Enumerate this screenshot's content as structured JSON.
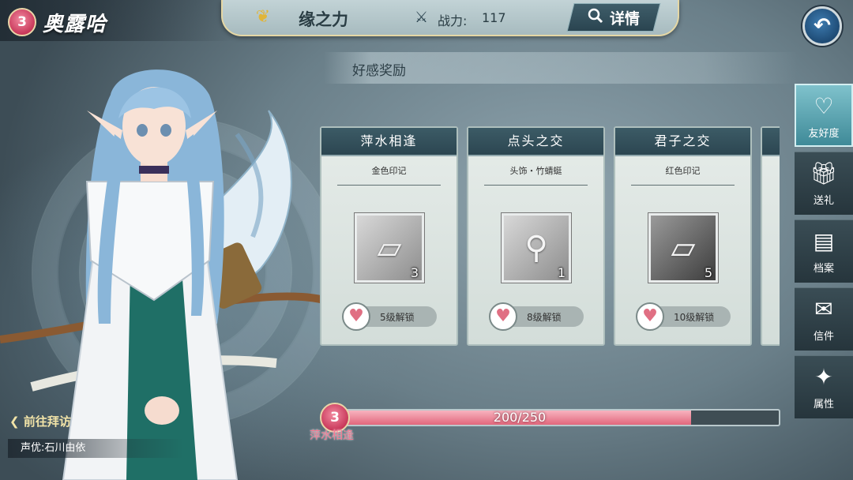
{
  "header": {
    "level": "3",
    "name": "奥露哈",
    "title": "缘之力",
    "power_label": "战力:",
    "power_value": "117",
    "detail_label": "详情",
    "icons": {
      "title": "golden-heart-icon",
      "power": "crossed-swords-icon",
      "detail": "search-icon",
      "back": "back-arrow-icon"
    }
  },
  "section": {
    "title": "好感奖励"
  },
  "cards": [
    {
      "title": "萍水相逢",
      "reward": "金色印记",
      "count": "3",
      "unlock": "5级解锁",
      "item": "seal-card-icon"
    },
    {
      "title": "点头之交",
      "reward": "头饰・竹蜻蜓",
      "count": "1",
      "unlock": "8级解锁",
      "item": "bamboo-dragonfly-icon"
    },
    {
      "title": "君子之交",
      "reward": "红色印记",
      "count": "5",
      "unlock": "10级解锁",
      "item": "seal-card-dark-icon"
    }
  ],
  "progress": {
    "level": "3",
    "text": "200/250",
    "fraction": 0.8,
    "stage": "萍水相逢"
  },
  "bottom": {
    "visit_label": "前往拜访",
    "voice_label": "声优:石川由依"
  },
  "sidebar": {
    "items": [
      {
        "label": "友好度",
        "icon": "heart-icon",
        "active": true
      },
      {
        "label": "送礼",
        "icon": "gift-icon",
        "active": false
      },
      {
        "label": "档案",
        "icon": "profile-icon",
        "active": false
      },
      {
        "label": "信件",
        "icon": "mail-icon",
        "active": false
      },
      {
        "label": "属性",
        "icon": "star-compass-icon",
        "active": false
      }
    ]
  },
  "colors": {
    "accent_pink": "#e2677c",
    "panel_teal": "#2c4651",
    "gold": "#e0b53a"
  }
}
